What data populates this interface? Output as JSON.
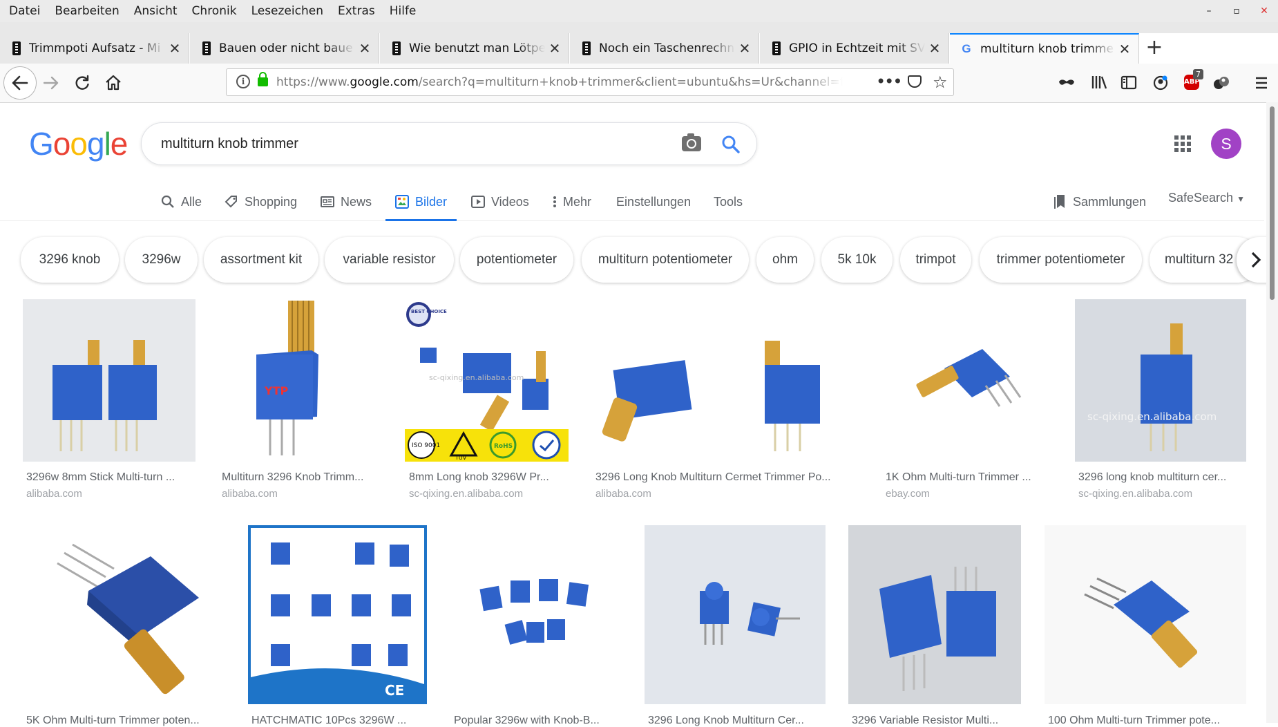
{
  "menu": [
    "Datei",
    "Bearbeiten",
    "Ansicht",
    "Chronik",
    "Lesezeichen",
    "Extras",
    "Hilfe"
  ],
  "window_controls": [
    "–",
    "▫",
    "✕"
  ],
  "tabs": [
    {
      "title": "Trimmpoti Aufsatz - Mi",
      "active": false
    },
    {
      "title": "Bauen oder nicht baue",
      "active": false
    },
    {
      "title": "Wie benutzt man Lötpe",
      "active": false
    },
    {
      "title": "Noch ein Taschenrechn",
      "active": false
    },
    {
      "title": "GPIO in Echtzeit mit SV",
      "active": false
    },
    {
      "title": "multiturn knob trimme",
      "active": true
    }
  ],
  "url": {
    "prefix": "https://www.",
    "domain": "google.com",
    "rest": "/search?q=multiturn+knob+trimmer&client=ubuntu&hs=Ur&channel=f"
  },
  "abp_badge": "7",
  "google": {
    "logo": [
      "G",
      "o",
      "o",
      "g",
      "l",
      "e"
    ],
    "query": "multiturn knob trimmer",
    "avatar_letter": "S"
  },
  "search_tabs": [
    "Alle",
    "Shopping",
    "News",
    "Bilder",
    "Videos",
    "Mehr",
    "Einstellungen",
    "Tools"
  ],
  "search_tab_active": "Bilder",
  "collections": "Sammlungen",
  "safesearch": "SafeSearch",
  "chips": [
    "3296 knob",
    "3296w",
    "assortment kit",
    "variable resistor",
    "potentiometer",
    "multiturn potentiometer",
    "ohm",
    "5k 10k",
    "trimpot",
    "trimmer potentiometer",
    "multiturn 32"
  ],
  "results_row1": [
    {
      "caption": "3296w 8mm Stick Multi-turn ...",
      "source": "alibaba.com"
    },
    {
      "caption": "Multiturn 3296 Knob Trimm...",
      "source": "alibaba.com"
    },
    {
      "caption": "8mm Long knob 3296W Pr...",
      "source": "sc-qixing.en.alibaba.com"
    },
    {
      "caption": "3296 Long Knob Multiturn Cermet Trimmer Po...",
      "source": "alibaba.com"
    },
    {
      "caption": "1K Ohm Multi-turn Trimmer ...",
      "source": "ebay.com"
    },
    {
      "caption": "3296 long knob multiturn cer...",
      "source": "sc-qixing.en.alibaba.com"
    }
  ],
  "results_row2": [
    {
      "caption": "5K Ohm Multi-turn Trimmer poten..."
    },
    {
      "caption": "HATCHMATIC 10Pcs 3296W ..."
    },
    {
      "caption": "Popular 3296w with Knob-B..."
    },
    {
      "caption": "3296 Long Knob Multiturn Cer..."
    },
    {
      "caption": "3296 Variable Resistor Multi..."
    },
    {
      "caption": "100 Ohm Multi-turn Trimmer pote..."
    }
  ],
  "image_text": {
    "badge": "BEST CHOICE",
    "watermark": "sc-qixing.en.alibaba.com",
    "iso": "ISO 9001",
    "tuv": "TÜV",
    "rohs": "RoHS",
    "ce": "CE"
  },
  "colors": {
    "accent": "#1a73e8",
    "trimmer_blue": "#2f62c9",
    "knob_gold": "#d6a23a",
    "avatar": "#a142c5"
  }
}
